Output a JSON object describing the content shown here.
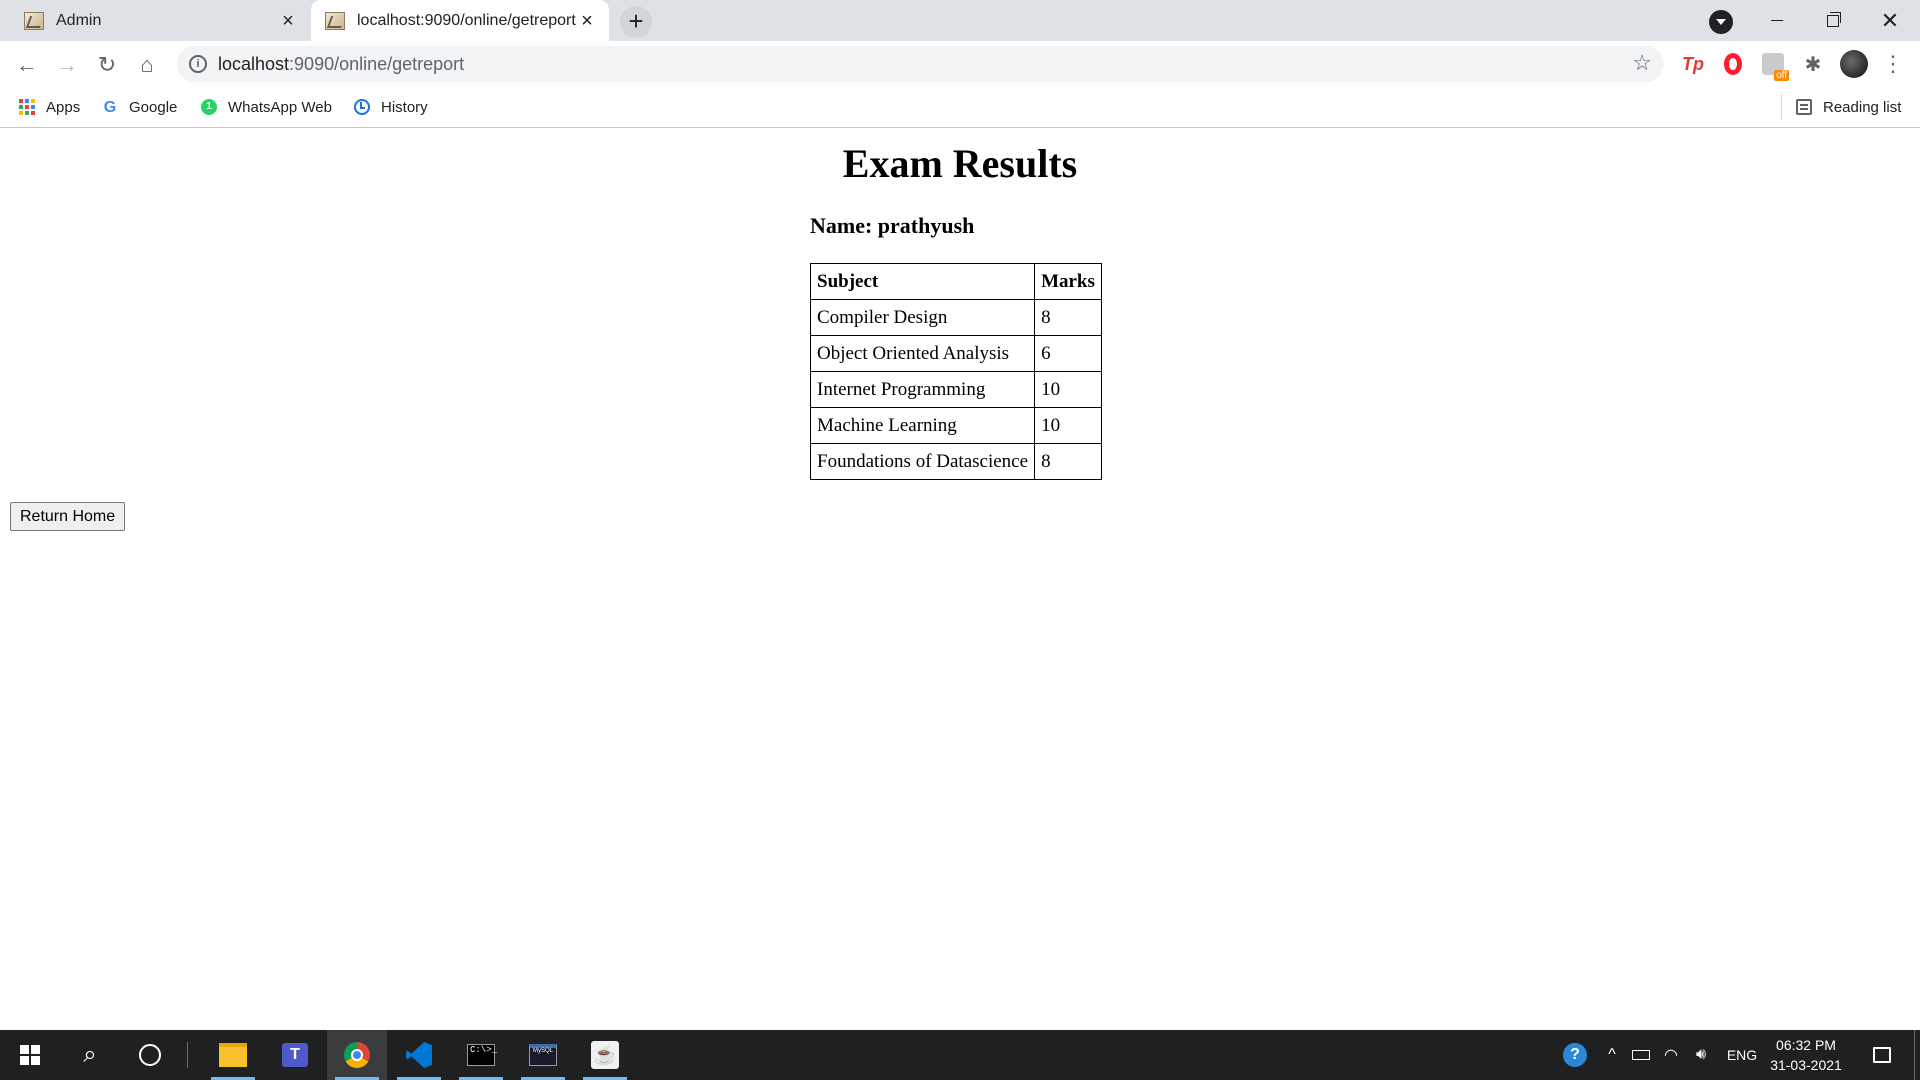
{
  "browser": {
    "tabs": [
      {
        "title": "Admin",
        "active": false
      },
      {
        "title": "localhost:9090/online/getreport",
        "active": true
      }
    ],
    "new_tab_label": "+",
    "address": {
      "host": "localhost",
      "path": ":9090/online/getreport"
    },
    "bookmarks": [
      {
        "label": "Apps",
        "icon": "apps-grid-icon"
      },
      {
        "label": "Google",
        "icon": "google-icon"
      },
      {
        "label": "WhatsApp Web",
        "icon": "whatsapp-icon"
      },
      {
        "label": "History",
        "icon": "history-icon"
      }
    ],
    "reading_list": "Reading list",
    "extensions": {
      "tp": "Tp"
    }
  },
  "page": {
    "heading": "Exam Results",
    "name_line": "Name: prathyush",
    "table": {
      "headers": [
        "Subject",
        "Marks"
      ],
      "rows": [
        [
          "Compiler Design",
          "8"
        ],
        [
          "Object Oriented Analysis",
          "6"
        ],
        [
          "Internet Programming",
          "10"
        ],
        [
          "Machine Learning",
          "10"
        ],
        [
          "Foundations of Datascience",
          "8"
        ]
      ]
    },
    "return_button": "Return Home"
  },
  "taskbar": {
    "apps": [
      "file-explorer",
      "teams",
      "chrome",
      "vscode",
      "command-prompt",
      "mysql",
      "java"
    ],
    "language": "ENG",
    "time": "06:32 PM",
    "date": "31-03-2021"
  },
  "colors": {
    "tabstrip": "#dee1e6",
    "taskbar": "#1f2022",
    "accent": "#1a73e8"
  }
}
